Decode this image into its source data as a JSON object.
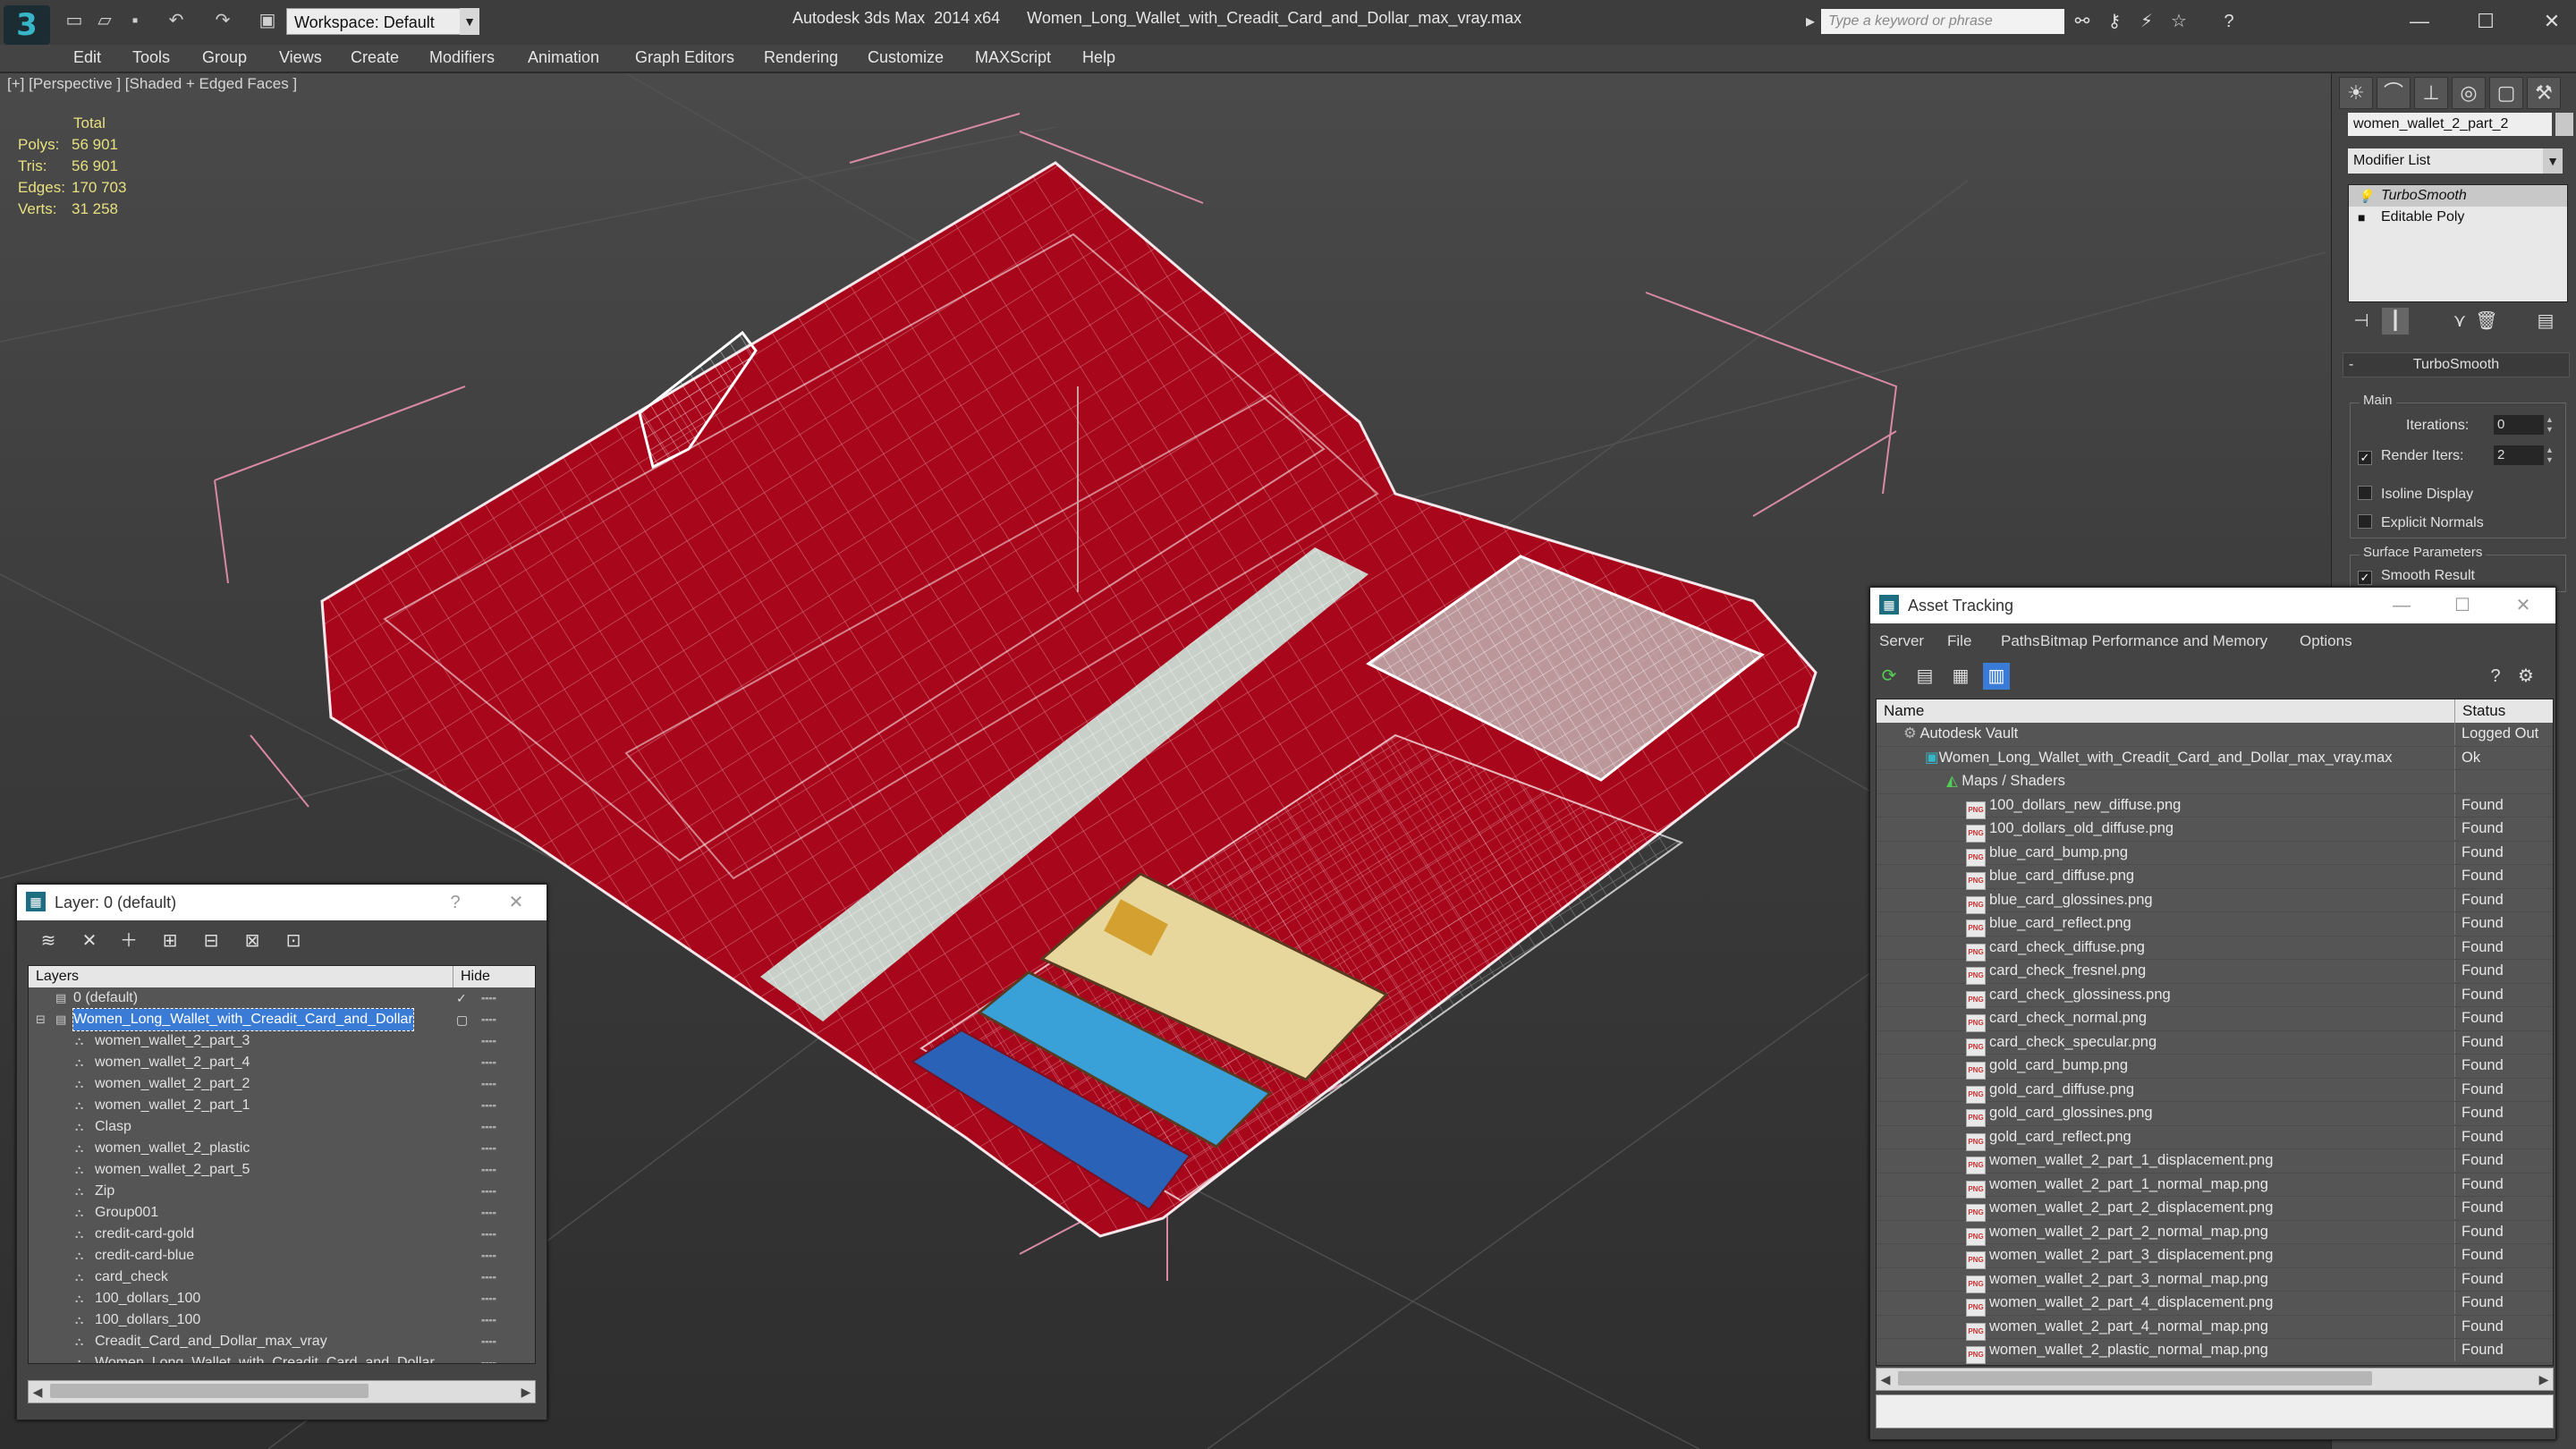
{
  "app": {
    "title": "Autodesk 3ds Max  2014 x64",
    "file": "Women_Long_Wallet_with_Creadit_Card_and_Dollar_max_vray.max",
    "workspace": "Workspace: Default",
    "search_placeholder": "Type a keyword or phrase"
  },
  "menu": [
    "Edit",
    "Tools",
    "Group",
    "Views",
    "Create",
    "Modifiers",
    "Animation",
    "Graph Editors",
    "Rendering",
    "Customize",
    "MAXScript",
    "Help"
  ],
  "viewport": {
    "label": "[+] [Perspective ] [Shaded + Edged Faces ]",
    "stats": {
      "header": "Total",
      "polys_label": "Polys:",
      "polys": "56 901",
      "tris_label": "Tris:",
      "tris": "56 901",
      "edges_label": "Edges:",
      "edges": "170 703",
      "verts_label": "Verts:",
      "verts": "31 258"
    }
  },
  "command_panel": {
    "object_name": "women_wallet_2_part_2",
    "modifier_list": "Modifier List",
    "stack": [
      "TurboSmooth",
      "Editable Poly"
    ],
    "rollout": "TurboSmooth",
    "main_label": "Main",
    "iterations_label": "Iterations:",
    "iterations": "0",
    "render_iters_label": "Render Iters:",
    "render_iters": "2",
    "isoline": "Isoline Display",
    "explicit": "Explicit Normals",
    "surface_label": "Surface Parameters",
    "smooth_result": "Smooth Result"
  },
  "layer_window": {
    "title": "Layer: 0 (default)",
    "help": "?",
    "col_layers": "Layers",
    "col_hide": "Hide",
    "rows": [
      "0 (default)",
      "Women_Long_Wallet_with_Creadit_Card_and_Dollar",
      "women_wallet_2_part_3",
      "women_wallet_2_part_4",
      "women_wallet_2_part_2",
      "women_wallet_2_part_1",
      "Clasp",
      "women_wallet_2_plastic",
      "women_wallet_2_part_5",
      "Zip",
      "Group001",
      "credit-card-gold",
      "credit-card-blue",
      "card_check",
      "100_dollars_100",
      "100_dollars_100",
      "Creadit_Card_and_Dollar_max_vray",
      "Women_Long_Wallet_with_Creadit_Card_and_Dollar"
    ]
  },
  "asset_window": {
    "title": "Asset Tracking",
    "menu": [
      "Server",
      "File",
      "Paths",
      "Bitmap Performance and Memory",
      "Options"
    ],
    "col_name": "Name",
    "col_status": "Status",
    "vault": {
      "name": "Autodesk Vault",
      "status": "Logged Out"
    },
    "file": {
      "name": "Women_Long_Wallet_with_Creadit_Card_and_Dollar_max_vray.max",
      "status": "Ok"
    },
    "group": "Maps / Shaders",
    "maps": [
      {
        "name": "100_dollars_new_diffuse.png",
        "status": "Found"
      },
      {
        "name": "100_dollars_old_diffuse.png",
        "status": "Found"
      },
      {
        "name": "blue_card_bump.png",
        "status": "Found"
      },
      {
        "name": "blue_card_diffuse.png",
        "status": "Found"
      },
      {
        "name": "blue_card_glossines.png",
        "status": "Found"
      },
      {
        "name": "blue_card_reflect.png",
        "status": "Found"
      },
      {
        "name": "card_check_diffuse.png",
        "status": "Found"
      },
      {
        "name": "card_check_fresnel.png",
        "status": "Found"
      },
      {
        "name": "card_check_glossiness.png",
        "status": "Found"
      },
      {
        "name": "card_check_normal.png",
        "status": "Found"
      },
      {
        "name": "card_check_specular.png",
        "status": "Found"
      },
      {
        "name": "gold_card_bump.png",
        "status": "Found"
      },
      {
        "name": "gold_card_diffuse.png",
        "status": "Found"
      },
      {
        "name": "gold_card_glossines.png",
        "status": "Found"
      },
      {
        "name": "gold_card_reflect.png",
        "status": "Found"
      },
      {
        "name": "women_wallet_2_part_1_displacement.png",
        "status": "Found"
      },
      {
        "name": "women_wallet_2_part_1_normal_map.png",
        "status": "Found"
      },
      {
        "name": "women_wallet_2_part_2_displacement.png",
        "status": "Found"
      },
      {
        "name": "women_wallet_2_part_2_normal_map.png",
        "status": "Found"
      },
      {
        "name": "women_wallet_2_part_3_displacement.png",
        "status": "Found"
      },
      {
        "name": "women_wallet_2_part_3_normal_map.png",
        "status": "Found"
      },
      {
        "name": "women_wallet_2_part_4_displacement.png",
        "status": "Found"
      },
      {
        "name": "women_wallet_2_part_4_normal_map.png",
        "status": "Found"
      },
      {
        "name": "women_wallet_2_plastic_normal_map.png",
        "status": "Found"
      }
    ]
  },
  "colors": {
    "wallet_red": "#a8061a",
    "wire": "#ffffff",
    "stats_yellow": "#e8e080",
    "selection": "#3a7bd5",
    "bbox_pink": "#d98aa3"
  }
}
